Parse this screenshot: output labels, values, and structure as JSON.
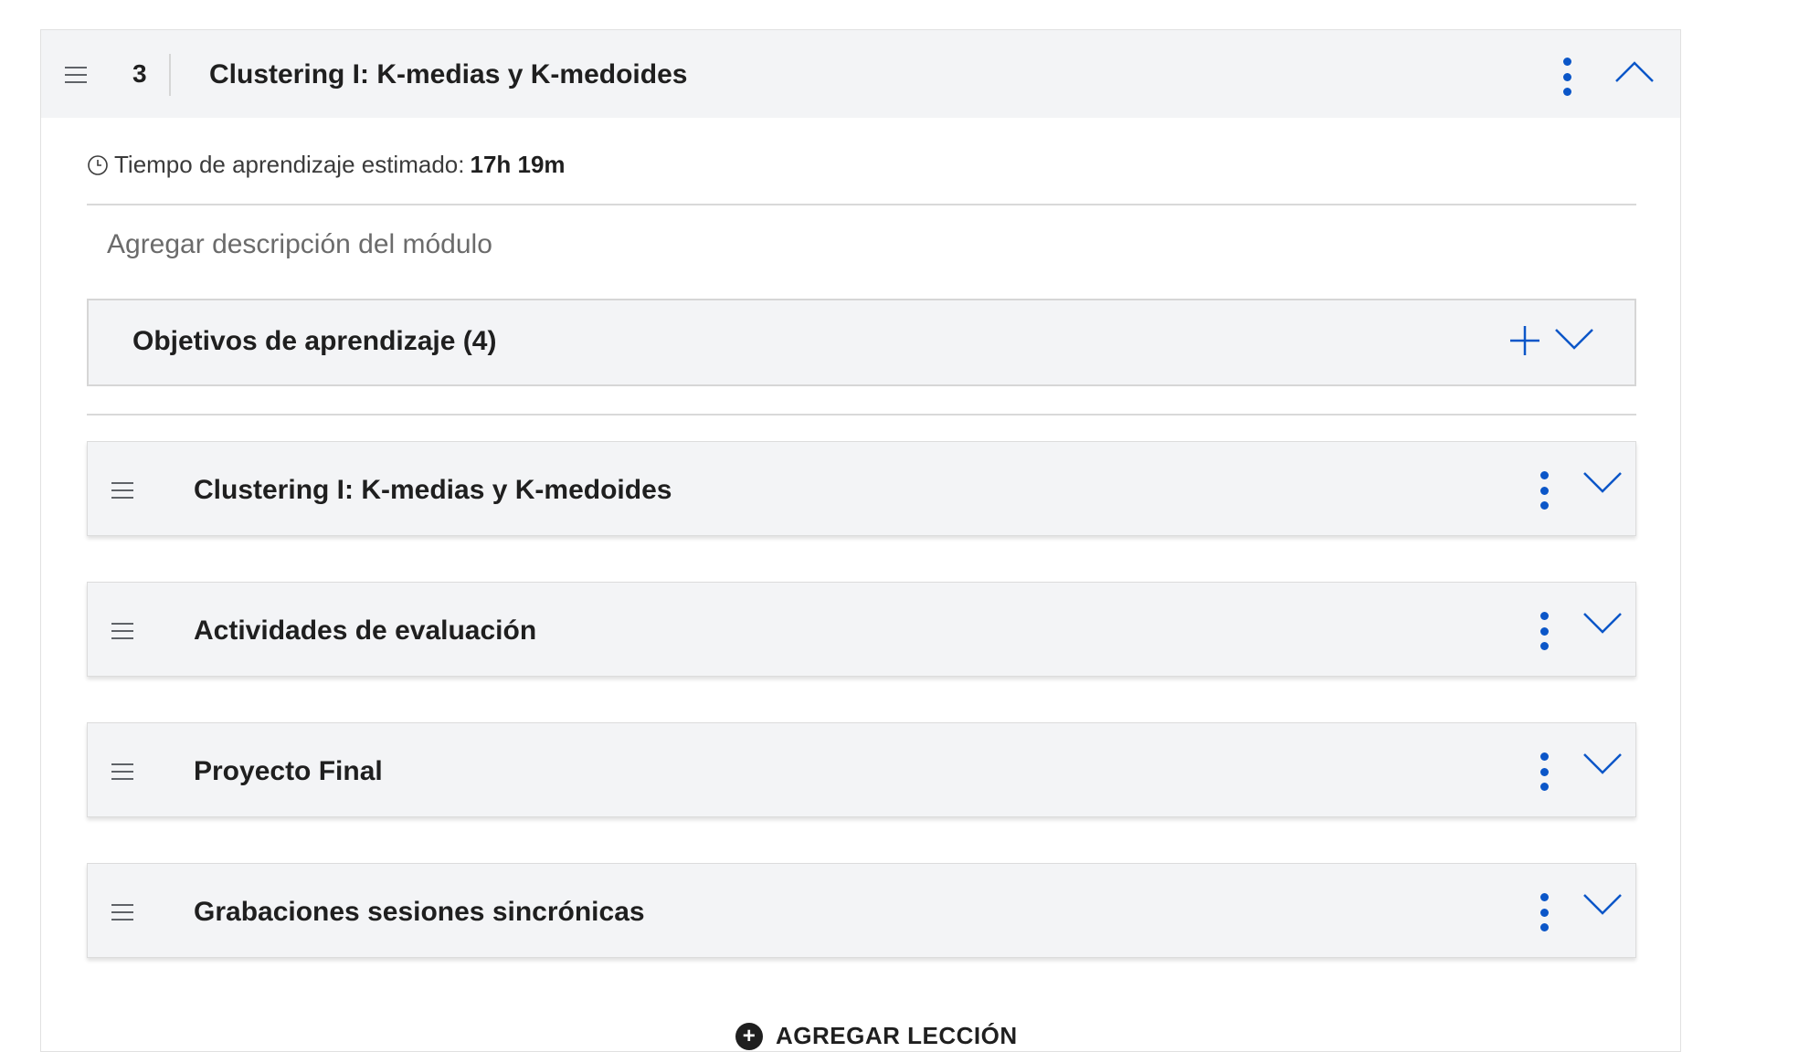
{
  "module": {
    "number": "3",
    "title": "Clustering I: K-medias y K-medoides",
    "time_label": "Tiempo de aprendizaje estimado:",
    "time_value": "17h 19m",
    "description_placeholder": "Agregar descripción del módulo"
  },
  "objectives": {
    "label": "Objetivos de aprendizaje (4)"
  },
  "lessons": [
    {
      "title": "Clustering I: K-medias y K-medoides"
    },
    {
      "title": "Actividades de evaluación"
    },
    {
      "title": "Proyecto Final"
    },
    {
      "title": "Grabaciones sesiones sincrónicas"
    }
  ],
  "add_lesson": {
    "label": "AGREGAR LECCIÓN"
  },
  "icons": {
    "drag": "drag-handle-icon",
    "kebab": "more-options-icon",
    "chevron_up": "chevron-up-icon",
    "chevron_down": "chevron-down-icon",
    "plus": "plus-icon",
    "clock": "clock-icon"
  },
  "colors": {
    "accent": "#0b56c8",
    "panel_bg": "#f3f4f6"
  }
}
